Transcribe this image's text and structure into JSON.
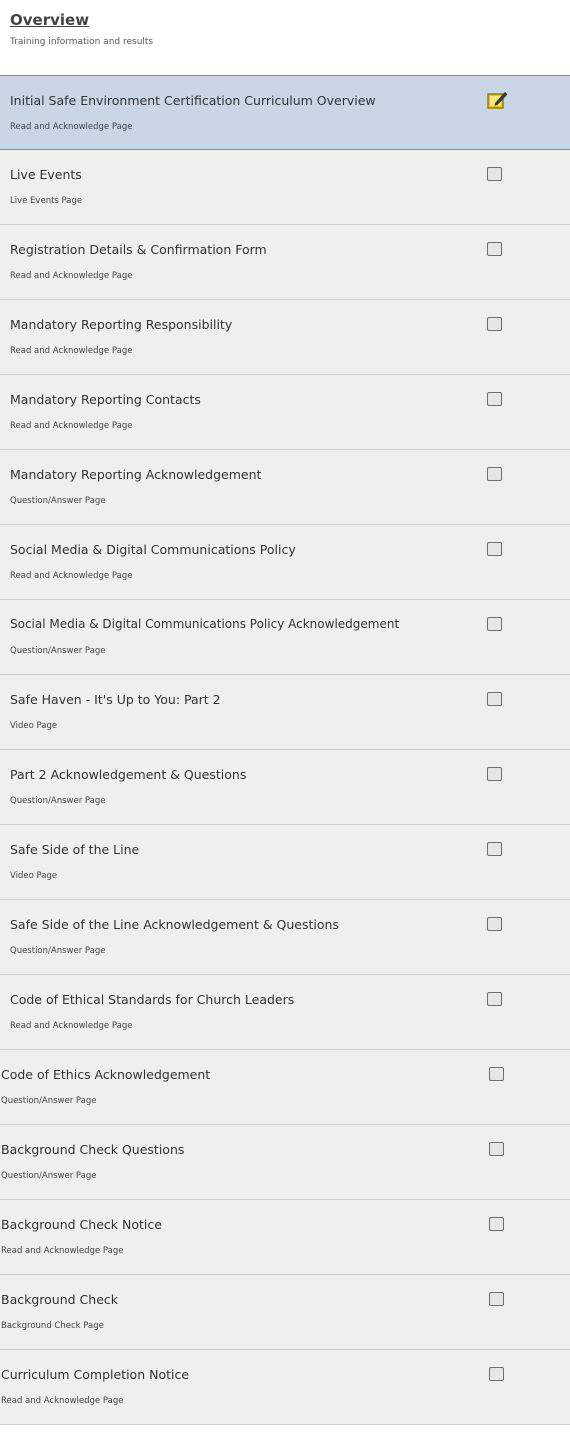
{
  "overview": {
    "title": "Overview",
    "subtitle": "Training information and results"
  },
  "items": [
    {
      "title": "Initial Safe Environment Certification Curriculum Overview",
      "type": "Read and Acknowledge Page"
    },
    {
      "title": "Live Events",
      "type": "Live Events Page"
    },
    {
      "title": "Registration Details & Confirmation Form",
      "type": "Read and Acknowledge Page"
    },
    {
      "title": "Mandatory Reporting Responsibility",
      "type": "Read and Acknowledge Page"
    },
    {
      "title": "Mandatory Reporting Contacts",
      "type": "Read and Acknowledge Page"
    },
    {
      "title": "Mandatory Reporting Acknowledgement",
      "type": "Question/Answer Page"
    },
    {
      "title": "Social Media & Digital Communications Policy",
      "type": "Read and Acknowledge Page"
    },
    {
      "title": "Social Media & Digital Communications Policy Acknowledgement",
      "type": "Question/Answer Page"
    },
    {
      "title": "Safe Haven - It's Up to You: Part 2",
      "type": "Video Page"
    },
    {
      "title": "Part 2 Acknowledgement & Questions",
      "type": "Question/Answer Page"
    },
    {
      "title": "Safe Side of the Line",
      "type": "Video Page"
    },
    {
      "title": "Safe Side of the Line Acknowledgement & Questions",
      "type": "Question/Answer Page"
    },
    {
      "title": "Code of Ethical Standards for Church Leaders",
      "type": "Read and Acknowledge Page"
    },
    {
      "title": "Code of Ethics Acknowledgement",
      "type": "Question/Answer Page"
    },
    {
      "title": "Background Check Questions",
      "type": "Question/Answer Page"
    },
    {
      "title": "Background Check Notice",
      "type": "Read and Acknowledge Page"
    },
    {
      "title": "Background Check",
      "type": "Background Check Page"
    },
    {
      "title": "Curriculum Completion Notice",
      "type": "Read and Acknowledge Page"
    }
  ],
  "colors": {
    "active_background": "#c9d6e6",
    "row_background": "#efefef",
    "edit_icon": "#f2c200"
  },
  "icons": {
    "active_item": "edit-icon",
    "inactive_item": "checkbox"
  }
}
